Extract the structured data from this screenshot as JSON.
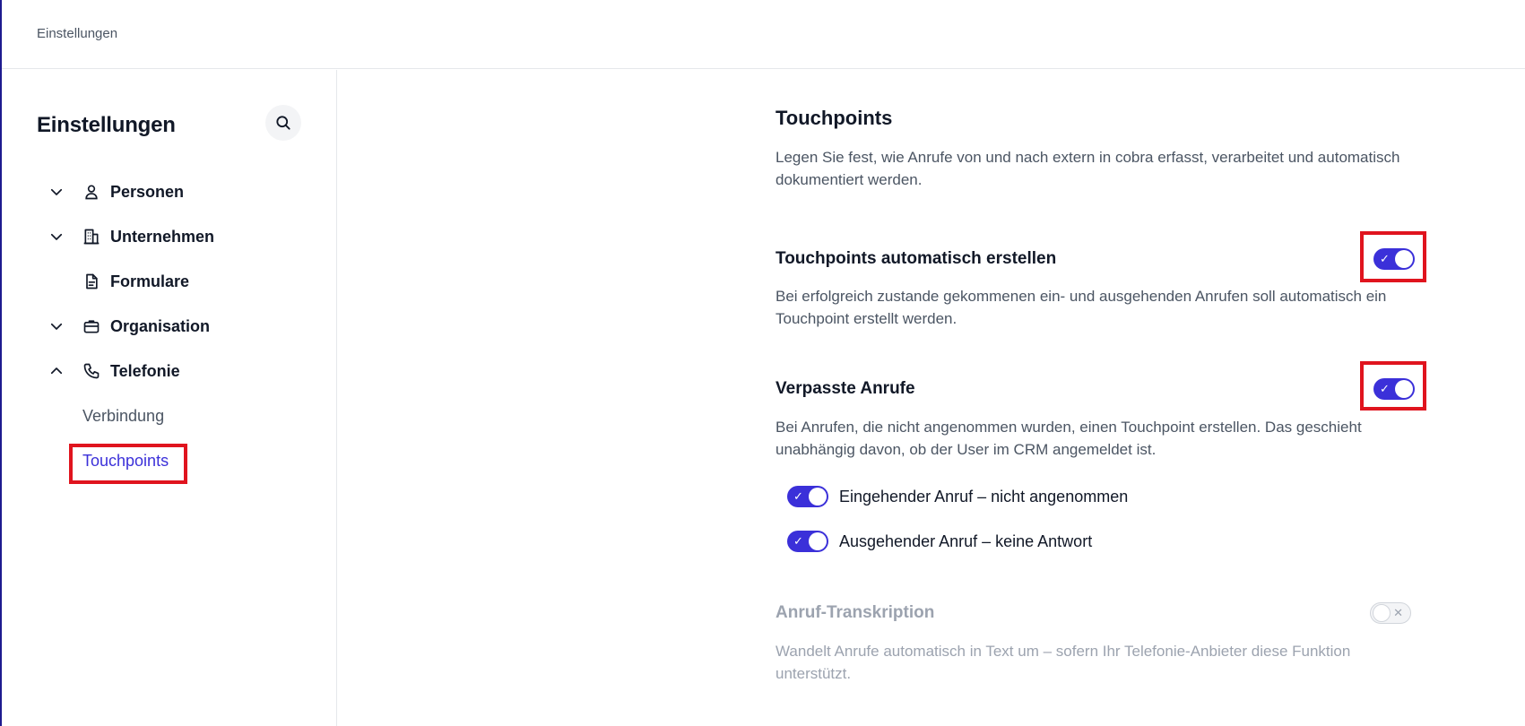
{
  "topbar": {
    "breadcrumb": "Einstellungen"
  },
  "sidebar": {
    "title": "Einstellungen",
    "search_icon": "search-icon",
    "items": [
      {
        "label": "Personen",
        "icon": "person-icon",
        "chevron": "chevron-down-icon"
      },
      {
        "label": "Unternehmen",
        "icon": "building-icon",
        "chevron": "chevron-down-icon"
      },
      {
        "label": "Formulare",
        "icon": "document-icon"
      },
      {
        "label": "Organisation",
        "icon": "briefcase-icon",
        "chevron": "chevron-down-icon"
      },
      {
        "label": "Telefonie",
        "icon": "phone-icon",
        "chevron": "chevron-up-icon"
      }
    ],
    "sub_items": [
      {
        "label": "Verbindung",
        "active": false
      },
      {
        "label": "Touchpoints",
        "active": true
      }
    ]
  },
  "main": {
    "title": "Touchpoints",
    "description": "Legen Sie fest, wie Anrufe von und nach extern in cobra erfasst, verarbeitet und automatisch dokumentiert werden.",
    "sections": [
      {
        "title": "Touchpoints automatisch erstellen",
        "description": "Bei erfolgreich zustande gekommenen ein- und ausgehenden Anrufen soll automatisch ein Touchpoint erstellt werden.",
        "enabled": true
      },
      {
        "title": "Verpasste Anrufe",
        "description": "Bei Anrufen, die nicht angenommen wurden, einen Touchpoint erstellen. Das geschieht unabhängig davon, ob der User im CRM angemeldet ist.",
        "enabled": true,
        "options": [
          {
            "label": "Eingehender Anruf – nicht angenommen",
            "enabled": true
          },
          {
            "label": "Ausgehender Anruf – keine Antwort",
            "enabled": true
          }
        ]
      },
      {
        "title": "Anruf-Transkription",
        "description": "Wandelt Anrufe automatisch in Text um – sofern Ihr Telefonie-Anbieter diese Funktion unterstützt.",
        "enabled": false,
        "disabled": true
      }
    ]
  },
  "colors": {
    "accent": "#3b30d9",
    "highlight": "#e0141e",
    "muted": "#9ca3af"
  }
}
